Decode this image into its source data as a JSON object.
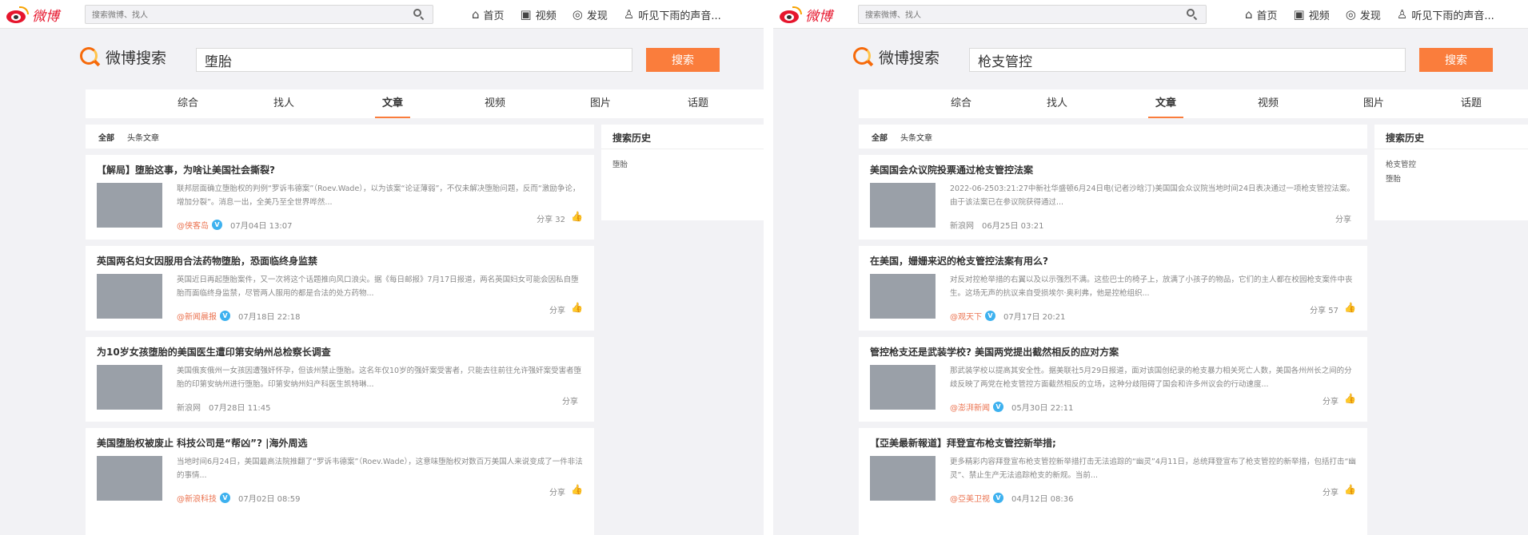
{
  "screens": [
    {
      "logo_text": "微博",
      "top_search_placeholder": "搜索微博、找人",
      "nav": [
        "首页",
        "视频",
        "发现",
        "听见下雨的声音..."
      ],
      "brand": "微博搜索",
      "query": "堕胎",
      "search_button": "搜索",
      "tabs": [
        "综合",
        "找人",
        "文章",
        "视频",
        "图片",
        "话题"
      ],
      "active_tab": "文章",
      "filters": [
        "全部",
        "头条文章"
      ],
      "history_title": "搜索历史",
      "history": [
        "堕胎"
      ],
      "articles": [
        {
          "title": "【解局】堕胎这事，为啥让美国社会撕裂?",
          "excerpt": "联邦层面确立堕胎权的判例“罗诉韦德案”（Roev.Wade），以为该案“论证薄弱”，不仅未解决堕胎问题，反而“激励争论，增加分裂”。消息一出，全美乃至全世界哗然...",
          "author": "@侠客岛",
          "date": "07月04日 13:07",
          "share": "分享 32"
        },
        {
          "title": "英国两名妇女因服用合法药物堕胎，恐面临终身监禁",
          "excerpt": "英国近日再起堕胎案件，又一次将这个话题推向风口浪尖。据《每日邮报》7月17日报道，两名英国妇女可能会因私自堕胎而面临终身监禁，尽管两人服用的都是合法的处方药物...",
          "author": "@新闻晨报",
          "date": "07月18日 22:18",
          "share": "分享"
        },
        {
          "title": "为10岁女孩堕胎的美国医生遭印第安纳州总检察长调查",
          "excerpt": "美国俄亥俄州一女孩因遭强奸怀孕，但该州禁止堕胎。这名年仅10岁的强奸案受害者，只能去往前往允许强奸案受害者堕胎的印第安纳州进行堕胎。印第安纳州妇产科医生凯特琳...",
          "author": "新浪网",
          "date": "07月28日 11:45",
          "share": "分享"
        },
        {
          "title": "美国堕胎权被废止 科技公司是“帮凶”? |海外周选",
          "excerpt": "当地时间6月24日，美国最高法院推翻了“罗诉韦德案”（Roev.Wade），这意味堕胎权对数百万美国人来说变成了一件非法的事情...",
          "author": "@新浪科技",
          "date": "07月02日 08:59",
          "share": "分享"
        }
      ]
    },
    {
      "logo_text": "微博",
      "top_search_placeholder": "搜索微博、找人",
      "nav": [
        "首页",
        "视频",
        "发现",
        "听见下雨的声音..."
      ],
      "brand": "微博搜索",
      "query": "枪支管控",
      "search_button": "搜索",
      "tabs": [
        "综合",
        "找人",
        "文章",
        "视频",
        "图片",
        "话题"
      ],
      "active_tab": "文章",
      "filters": [
        "全部",
        "头条文章"
      ],
      "history_title": "搜索历史",
      "history": [
        "枪支管控",
        "堕胎"
      ],
      "articles": [
        {
          "title": "美国国会众议院投票通过枪支管控法案",
          "excerpt": "2022-06-2503:21:27中新社华盛顿6月24日电(记者沙晗汀)美国国会众议院当地时间24日表决通过一项枪支管控法案。由于该法案已在参议院获得通过...",
          "author": "新浪网",
          "date": "06月25日 03:21",
          "share": "分享"
        },
        {
          "title": "在美国，姗姗来迟的枪支管控法案有用么?",
          "excerpt": "对反对控枪举措的右翼以及以示强烈不满。这些巴士的椅子上，放满了小孩子的物品，它们的主人都在校园枪支案件中丧生。这场无声的抗议来自受损埃尔·奥利弗，他是控枪组织...",
          "author": "@观天下",
          "date": "07月17日 20:21",
          "share": "分享 57"
        },
        {
          "title": "管控枪支还是武装学校? 美国两党提出截然相反的应对方案",
          "excerpt": "那武装学校以提高其安全性。据美联社5月29日报道，面对该国创纪录的枪支暴力相关死亡人数，美国各州州长之间的分歧反映了两党在枪支管控方面截然相反的立场，这种分歧阻碍了国会和许多州议会的行动速度...",
          "author": "@澎湃新闻",
          "date": "05月30日 22:11",
          "share": "分享"
        },
        {
          "title": "【亞美最新報道】拜登宣布枪支管控新举措;",
          "excerpt": "更多精彩内容拜登宣布枪支管控新举措打击无法追踪的“幽灵”4月11日，总统拜登宣布了枪支管控的新举措，包括打击“幽灵”、禁止生产无法追踪枪支的新规。当前...",
          "author": "@亞美卫视",
          "date": "04月12日 08:36",
          "share": "分享"
        }
      ]
    }
  ]
}
